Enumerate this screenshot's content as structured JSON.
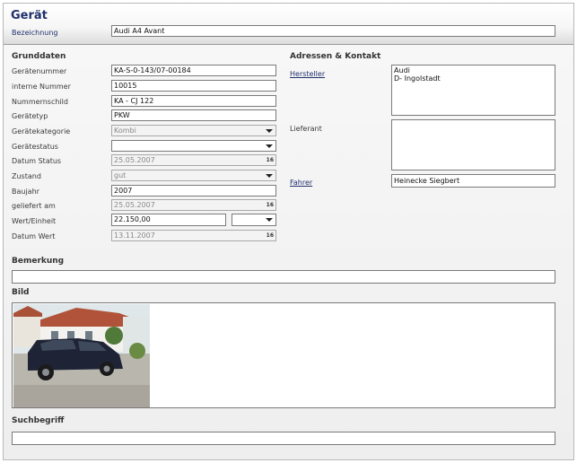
{
  "header": {
    "title": "Gerät",
    "bezeichnung_label": "Bezeichnung",
    "bezeichnung_value": "Audi A4 Avant"
  },
  "grunddaten": {
    "heading": "Grunddaten",
    "geraetenummer": {
      "label": "Gerätenummer",
      "value": "KA-S-0-143/07-00184"
    },
    "interne_nummer": {
      "label": "interne Nummer",
      "value": "10015"
    },
    "nummernschild": {
      "label": "Nummernschild",
      "value": "KA - CJ 122"
    },
    "geraetetyp": {
      "label": "Gerätetyp",
      "value": "PKW"
    },
    "geraetekategorie": {
      "label": "Gerätekategorie",
      "value": "Kombi"
    },
    "geraetestatus": {
      "label": "Gerätestatus",
      "value": ""
    },
    "datum_status": {
      "label": "Datum Status",
      "value": "25.05.2007"
    },
    "zustand": {
      "label": "Zustand",
      "value": "gut"
    },
    "baujahr": {
      "label": "Baujahr",
      "value": "2007"
    },
    "geliefert_am": {
      "label": "geliefert am",
      "value": "25.05.2007"
    },
    "wert_einheit": {
      "label": "Wert/Einheit",
      "value": "22.150,00",
      "unit": ""
    },
    "datum_wert": {
      "label": "Datum Wert",
      "value": "13.11.2007"
    },
    "calendar_glyph": "16"
  },
  "adressen": {
    "heading": "Adressen & Kontakt",
    "hersteller_label": "Hersteller",
    "hersteller_value": "Audi\nD- Ingolstadt",
    "lieferant_label": "Lieferant",
    "lieferant_value": "",
    "fahrer_label": "Fahrer",
    "fahrer_value": "Heinecke Siegbert"
  },
  "bemerkung": {
    "heading": "Bemerkung",
    "value": ""
  },
  "bild": {
    "heading": "Bild",
    "icon": "car-photo"
  },
  "suchbegriff": {
    "heading": "Suchbegriff",
    "value": ""
  },
  "colors": {
    "title": "#1f2f6b",
    "link": "#1f2f6b",
    "border": "#7a7a7a"
  }
}
